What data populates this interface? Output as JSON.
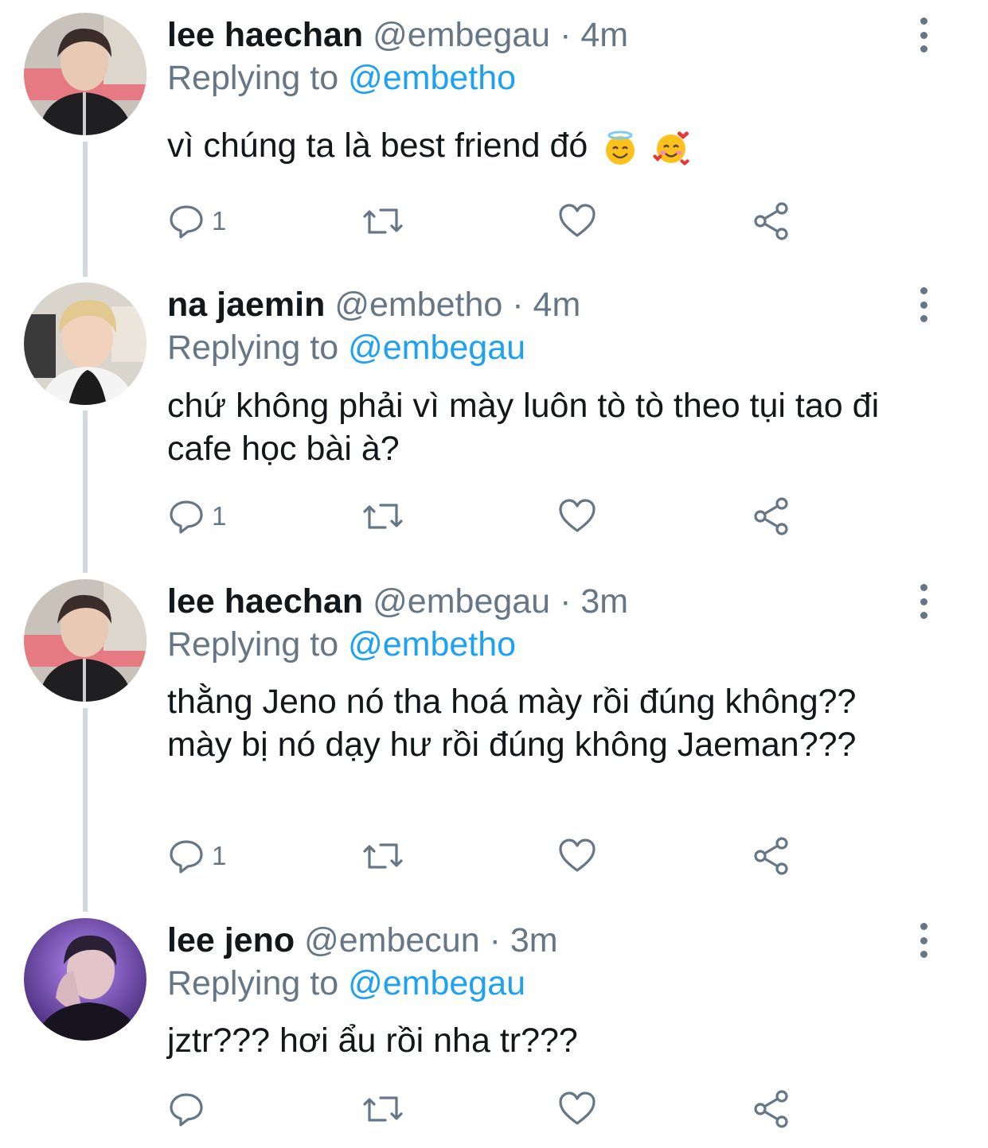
{
  "tweets": [
    {
      "name": "lee haechan",
      "handle": "@embegau",
      "separator": "·",
      "time": "4m",
      "replying_prefix": "Replying to",
      "replying_to": "@embetho",
      "text": "vì chúng ta là best friend đó",
      "emojis": [
        "smiling-face-with-halo",
        "smiling-face-with-hearts"
      ],
      "reply_count": "1",
      "avatar": "lee-haechan-photo"
    },
    {
      "name": "na jaemin",
      "handle": "@embetho",
      "separator": "·",
      "time": "4m",
      "replying_prefix": "Replying to",
      "replying_to": "@embegau",
      "text": "chứ không phải vì mày luôn tò tò theo tụi tao đi cafe học bài à?",
      "reply_count": "1",
      "avatar": "na-jaemin-photo"
    },
    {
      "name": "lee haechan",
      "handle": "@embegau",
      "separator": "·",
      "time": "3m",
      "replying_prefix": "Replying to",
      "replying_to": "@embetho",
      "text": "thằng Jeno nó tha hoá mày rồi đúng không?? mày bị nó dạy hư rồi đúng không Jaeman???",
      "reply_count": "1",
      "avatar": "lee-haechan-photo"
    },
    {
      "name": "lee jeno",
      "handle": "@embecun",
      "separator": "·",
      "time": "3m",
      "replying_prefix": "Replying to",
      "replying_to": "@embegau",
      "text": "jztr??? hơi ẩu rồi nha tr???",
      "reply_count": "",
      "avatar": "lee-jeno-photo"
    }
  ],
  "icons": {
    "reply": "comment-bubble-icon",
    "retweet": "retweet-icon",
    "like": "heart-icon",
    "share": "share-icon",
    "more": "more-vertical-icon"
  },
  "colors": {
    "name": "#14171a",
    "secondary": "#657786",
    "link": "#1da1f2",
    "thread_line": "#cfd9de"
  }
}
